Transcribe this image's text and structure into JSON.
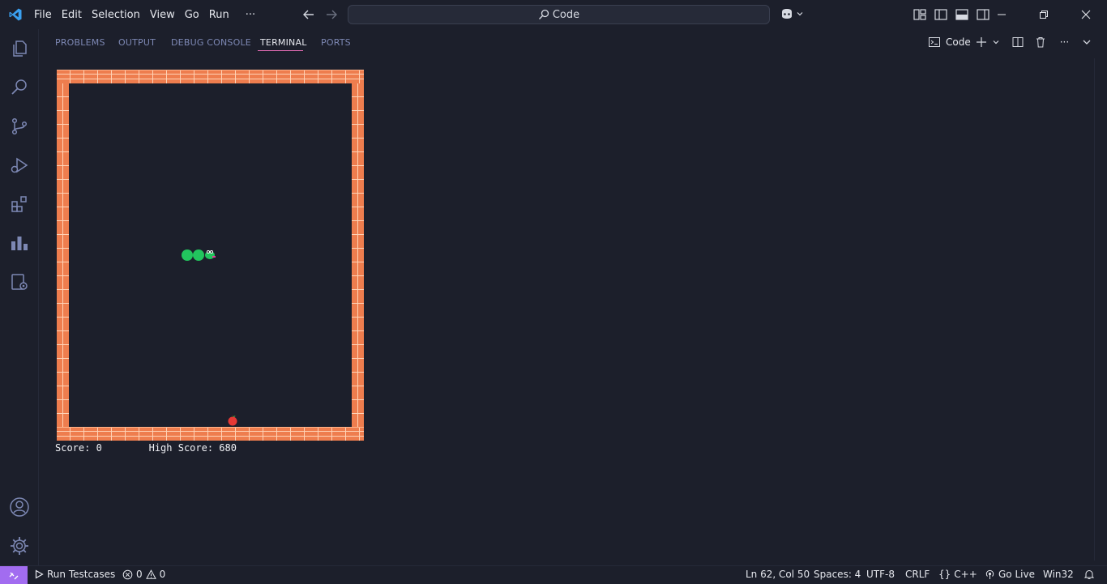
{
  "menu": [
    "File",
    "Edit",
    "Selection",
    "View",
    "Go",
    "Run",
    "···"
  ],
  "command_center": {
    "label": "Code"
  },
  "panel": {
    "tabs": [
      "PROBLEMS",
      "OUTPUT",
      "DEBUG CONSOLE",
      "TERMINAL",
      "PORTS"
    ],
    "active_tab": "TERMINAL",
    "terminal_name": "Code"
  },
  "game": {
    "score_text": "Score: 0",
    "high_score_text": "High Score: 680",
    "colors": {
      "brick": "#ee7d4e",
      "snake": "#22c55e",
      "apple": "#e53935"
    }
  },
  "statusbar": {
    "run_testcases": "Run Testcases",
    "errors": "0",
    "warnings": "0",
    "position": "Ln 62, Col 50",
    "spaces": "Spaces: 4",
    "encoding": "UTF-8",
    "eol": "CRLF",
    "language": "C++",
    "go_live": "Go Live",
    "platform": "Win32"
  },
  "colors": {
    "accent": "#a26cf0",
    "tab_underline": "#e06bb2",
    "background": "#1c1f2b"
  }
}
